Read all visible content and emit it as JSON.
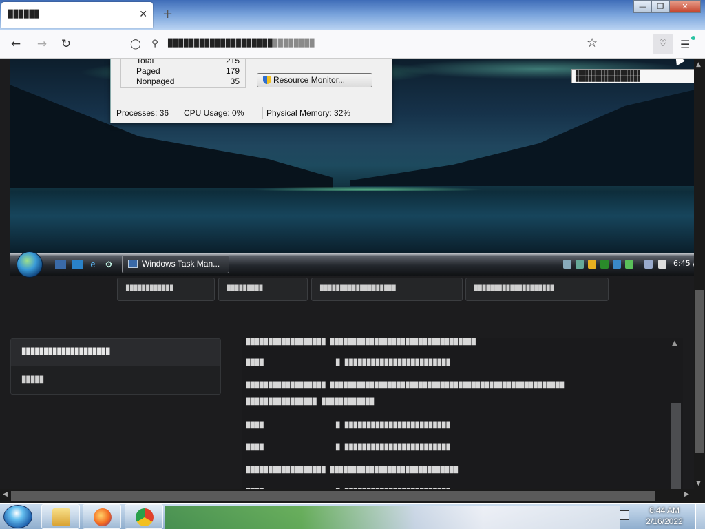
{
  "browser": {
    "tab_title": "██████",
    "tab_close": "✕",
    "new_tab": "+",
    "url_main": "████████████████████",
    "url_dim": "████████",
    "window_buttons": {
      "minimize": "—",
      "restore": "❐",
      "close": "✕"
    }
  },
  "task_manager": {
    "rows": [
      {
        "label": "Total",
        "value": "215"
      },
      {
        "label": "Paged",
        "value": "179"
      },
      {
        "label": "Nonpaged",
        "value": "35"
      }
    ],
    "resource_monitor_button": "Resource Monitor...",
    "status": {
      "processes": "Processes: 36",
      "cpu": "CPU Usage: 0%",
      "memory": "Physical Memory: 32%"
    }
  },
  "tooltip": {
    "line1": "████████████████████",
    "line2": "████████████████████"
  },
  "remote_taskbar": {
    "task_button": "Windows Task Man...",
    "clock": "6:45 /"
  },
  "chips": [
    "████████████",
    "█████████",
    "███████████████████",
    "████████████████████"
  ],
  "sidebar": {
    "items": [
      "████████████████████",
      "█████"
    ]
  },
  "log": {
    "lines": [
      {
        "k": "██████████████████",
        "v": "█████████████████████████████████"
      },
      {
        "k": "████",
        "v": "█ ████████████████████████"
      },
      {
        "k": "██████████████████",
        "v": "█████████████████████████████████████████████████████"
      },
      {
        "k": "████████████████",
        "v": "████████████"
      },
      {
        "k": "████",
        "v": "█ ████████████████████████"
      },
      {
        "k": "████",
        "v": "█ ████████████████████████"
      },
      {
        "k": "██████████████████",
        "v": "█████████████████████████████"
      },
      {
        "k": "████",
        "v": "█ ████████████████████████"
      }
    ]
  },
  "taskbar": {
    "time": "6:44 AM",
    "date": "2/16/2022"
  },
  "colors": {
    "accent": "#2ac3a2",
    "page_bg": "#1c1c1e"
  }
}
